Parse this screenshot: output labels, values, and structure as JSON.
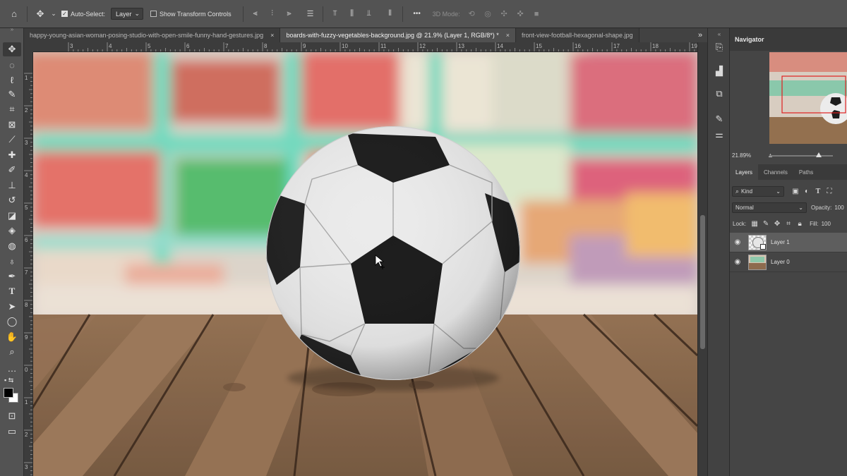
{
  "options_bar": {
    "auto_select_label": "Auto-Select:",
    "auto_select_checked": true,
    "auto_select_target": "Layer",
    "show_transform_label": "Show Transform Controls",
    "show_transform_checked": false,
    "more_label": "•••",
    "mode_3d_label": "3D Mode:"
  },
  "tabs": [
    {
      "label": "happy-young-asian-woman-posing-studio-with-open-smile-funny-hand-gestures.jpg",
      "close": "×",
      "active": false
    },
    {
      "label": "boards-with-fuzzy-vegetables-background.jpg @ 21.9% (Layer 1, RGB/8*) *",
      "close": "×",
      "active": true
    },
    {
      "label": "front-view-football-hexagonal-shape.jpg",
      "close": "",
      "active": false
    }
  ],
  "tabs_overflow": "»",
  "ruler": {
    "top": [
      "3",
      "4",
      "5",
      "6",
      "7",
      "8",
      "9",
      "10",
      "11",
      "12",
      "13",
      "14",
      "15",
      "16",
      "17",
      "18",
      "19"
    ],
    "left": [
      "1",
      "2",
      "3",
      "4",
      "5",
      "6",
      "7",
      "8",
      "9",
      "0",
      "1",
      "2",
      "3"
    ]
  },
  "navigator": {
    "title": "Navigator",
    "zoom": "21.89%"
  },
  "layers_panel": {
    "tabs": [
      "Layers",
      "Channels",
      "Paths"
    ],
    "active_tab": "Layers",
    "filter_kind": "Kind",
    "blend_mode": "Normal",
    "opacity_label": "Opacity:",
    "opacity_value": "100",
    "lock_label": "Lock:",
    "fill_label": "Fill:",
    "fill_value": "100",
    "layers": [
      {
        "name": "Layer 1",
        "selected": true
      },
      {
        "name": "Layer 0",
        "selected": false
      }
    ]
  },
  "colors": {
    "ui_bg": "#535353",
    "panel_bg": "#454545",
    "canvas_floor": "#8a6a4e",
    "ball_black": "#1f1f1f",
    "ball_white": "#e8e8e8"
  }
}
